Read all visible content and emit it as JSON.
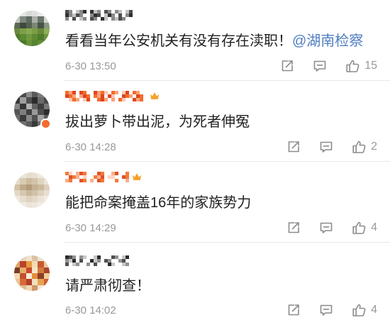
{
  "theme": {
    "text_color": "#222222",
    "mention_color": "#4f7ec0",
    "meta_color": "#999999",
    "icon_color": "#8c8c8c",
    "separator_color": "#e8e8e8"
  },
  "icons": {
    "forward": "forward-icon",
    "comment": "comment-icon",
    "like": "like-icon"
  },
  "comments": [
    {
      "text": "看看当年公安机关有没有存在渎职！",
      "mention": "@湖南检察",
      "time": "6-30 13:50",
      "likes": "15"
    },
    {
      "text": "拔出萝卜带出泥，为死者伸冤",
      "time": "6-30 14:28",
      "likes": "2"
    },
    {
      "text": "能把命案掩盖16年的家族势力",
      "time": "6-30 14:29",
      "likes": "4"
    },
    {
      "text": "请严肃彻查！",
      "time": "6-30 14:02",
      "likes": "4"
    }
  ]
}
